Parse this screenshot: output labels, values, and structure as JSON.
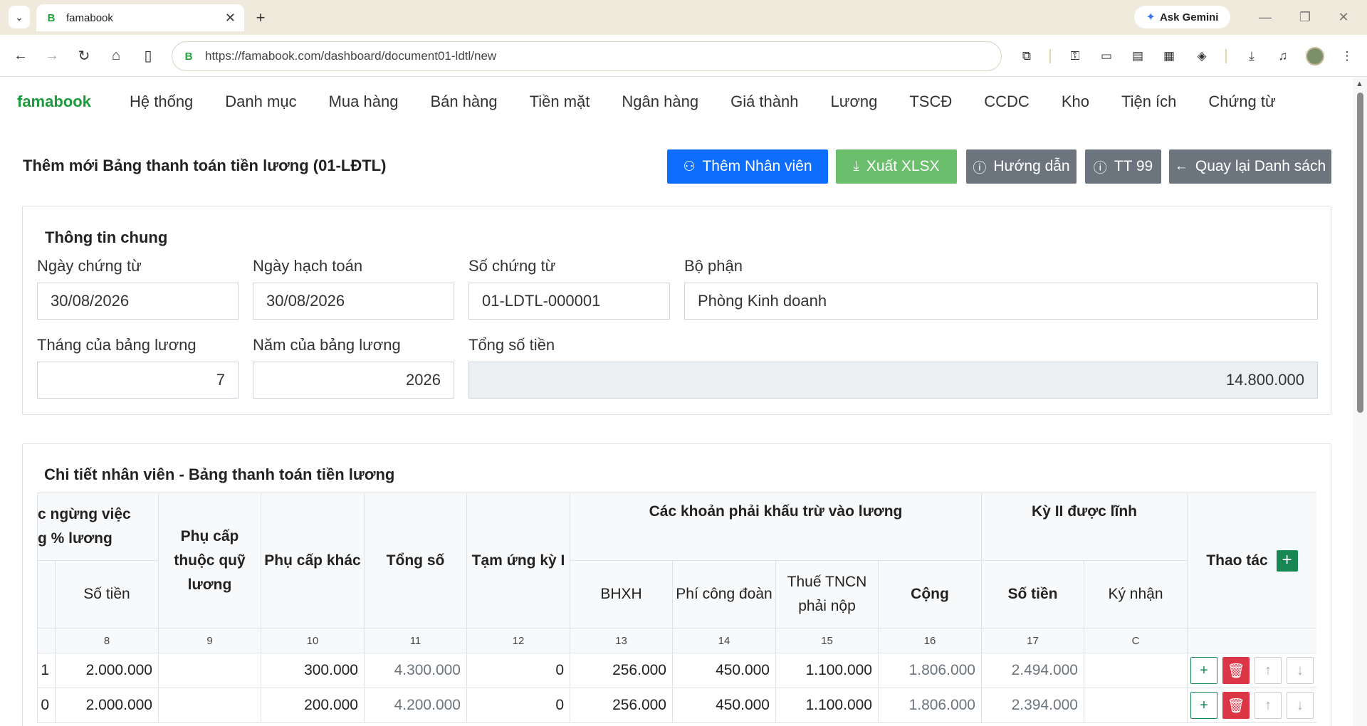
{
  "browser": {
    "tab_title": "famabook",
    "favicon": "B",
    "url": "https://famabook.com/dashboard/document01-ldtl/new",
    "gemini_label": "Ask Gemini"
  },
  "nav": {
    "brand": "famabook",
    "items": [
      "Hệ thống",
      "Danh mục",
      "Mua hàng",
      "Bán hàng",
      "Tiền mặt",
      "Ngân hàng",
      "Giá thành",
      "Lương",
      "TSCĐ",
      "CCDC",
      "Kho",
      "Tiện ích",
      "Chứng từ"
    ]
  },
  "page": {
    "title": "Thêm mới Bảng thanh toán tiền lương (01-LĐTL)",
    "buttons": {
      "add_employee": "Thêm Nhân viên",
      "export": "Xuất XLSX",
      "guide": "Hướng dẫn",
      "tt99": "TT 99",
      "back": "Quay lại Danh sách"
    }
  },
  "general": {
    "heading": "Thông tin chung",
    "doc_date_label": "Ngày chứng từ",
    "doc_date": "30/08/2026",
    "acc_date_label": "Ngày hạch toán",
    "acc_date": "30/08/2026",
    "doc_no_label": "Số chứng từ",
    "doc_no": "01-LDTL-000001",
    "dept_label": "Bộ phận",
    "dept": "Phòng Kinh doanh",
    "month_label": "Tháng của bảng lương",
    "month": "7",
    "year_label": "Năm của bảng lương",
    "year": "2026",
    "total_label": "Tổng số tiền",
    "total": "14.800.000"
  },
  "detail": {
    "heading": "Chi tiết nhân viên - Bảng thanh toán tiền lương",
    "headers": {
      "stop_work": "c ngừng việc g % lương",
      "stop_work_l1": "c ngừng việc",
      "stop_work_l2": "g % lương",
      "amount": "Số tiền",
      "allow_fund": "Phụ cấp thuộc quỹ lương",
      "allow_other": "Phụ cấp khác",
      "total": "Tổng số",
      "advance": "Tạm ứng kỳ I",
      "deductions": "Các khoản phải khấu trừ vào lương",
      "bhxh": "BHXH",
      "union_fee": "Phí công đoàn",
      "pit": "Thuế TNCN phải nộp",
      "sum": "Cộng",
      "period2": "Kỳ II được lĩnh",
      "p2_amount": "Số tiền",
      "sign": "Ký nhận",
      "actions": "Thao tác"
    },
    "col_numbers": [
      "",
      "8",
      "9",
      "10",
      "11",
      "12",
      "13",
      "14",
      "15",
      "16",
      "17",
      "C"
    ],
    "rows": [
      {
        "c0": "1",
        "amount": "2.000.000",
        "fund": "",
        "other": "300.000",
        "total": "4.300.000",
        "adv": "0",
        "bhxh": "256.000",
        "union": "450.000",
        "pit": "1.100.000",
        "sum": "1.806.000",
        "p2": "2.494.000",
        "sign": ""
      },
      {
        "c0": "0",
        "amount": "2.000.000",
        "fund": "",
        "other": "200.000",
        "total": "4.200.000",
        "adv": "0",
        "bhxh": "256.000",
        "union": "450.000",
        "pit": "1.100.000",
        "sum": "1.806.000",
        "p2": "2.394.000",
        "sign": ""
      }
    ]
  }
}
